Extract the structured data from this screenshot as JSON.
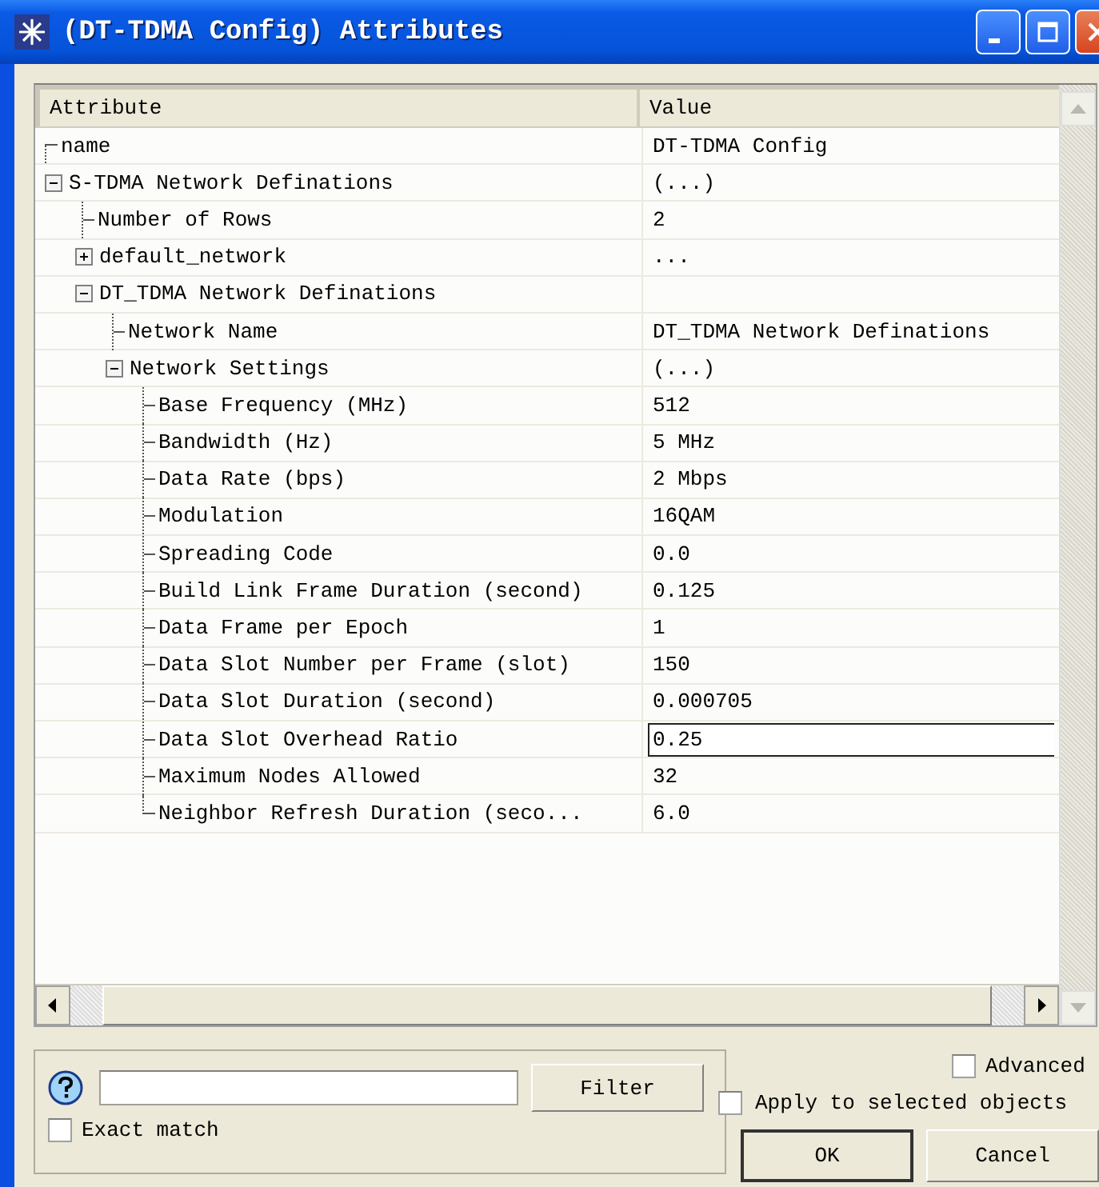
{
  "window": {
    "title": "(DT-TDMA Config) Attributes"
  },
  "table": {
    "columns": [
      "Attribute",
      "Value"
    ],
    "rows": [
      {
        "name": "name",
        "value": "DT-TDMA Config"
      },
      {
        "name": "S-TDMA Network Definations",
        "value": "(...)",
        "expanded": true,
        "children": [
          {
            "name": "Number of Rows",
            "value": "2"
          },
          {
            "name": "default_network",
            "value": "...",
            "expanded": false
          },
          {
            "name": "DT_TDMA Network Definations",
            "expanded": true,
            "children": [
              {
                "name": "Network Name",
                "value": "DT_TDMA Network Definations"
              },
              {
                "name": "Network Settings",
                "value": "(...)",
                "expanded": true,
                "children": [
                  {
                    "name": "Base Frequency (MHz)",
                    "value": "512",
                    "editing": false
                  },
                  {
                    "name": "Bandwidth (Hz)",
                    "value": "5 MHz",
                    "editing": false
                  },
                  {
                    "name": "Data Rate (bps)",
                    "value": "2 Mbps",
                    "editing": false
                  },
                  {
                    "name": "Modulation",
                    "value": "16QAM",
                    "editing": false
                  },
                  {
                    "name": "Spreading Code",
                    "value": "0.0",
                    "editing": false
                  },
                  {
                    "name": "Build Link Frame Duration (second)",
                    "value": "0.125",
                    "editing": false
                  },
                  {
                    "name": "Data Frame per Epoch",
                    "value": "1",
                    "editing": false
                  },
                  {
                    "name": "Data Slot Number per Frame (slot)",
                    "value": "150",
                    "editing": false
                  },
                  {
                    "name": "Data Slot Duration (second)",
                    "value": "0.000705",
                    "editing": false
                  },
                  {
                    "name": "Data Slot Overhead Ratio",
                    "value": "0.25",
                    "editing": true
                  },
                  {
                    "name": "Maximum Nodes Allowed",
                    "value": "32",
                    "editing": false
                  },
                  {
                    "name": "Neighbor Refresh Duration (seco...",
                    "value": "6.0",
                    "editing": false
                  }
                ]
              }
            ]
          }
        ]
      }
    ]
  },
  "filter": {
    "button": {
      "label": "Filter"
    },
    "exact_match": {
      "label": "Exact match",
      "checked": false
    }
  },
  "advanced": {
    "label": "Advanced",
    "checked": false
  },
  "apply_to_selected": {
    "label": "Apply to selected objects",
    "checked": false
  },
  "buttons": [
    {
      "label": "OK"
    },
    {
      "label": "Cancel"
    }
  ]
}
